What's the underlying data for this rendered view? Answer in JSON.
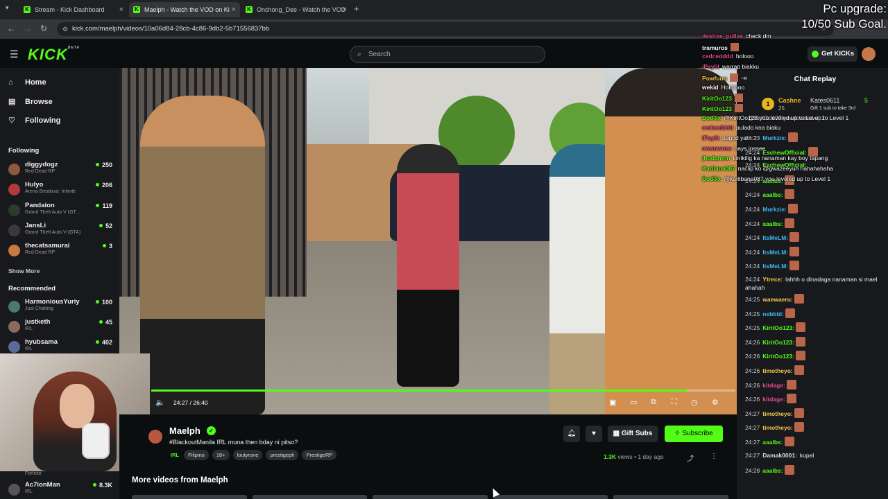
{
  "browser": {
    "tabs": [
      {
        "title": "Stream - Kick Dashboard",
        "active": false
      },
      {
        "title": "Maelph - Watch the VOD on Ki",
        "active": true
      },
      {
        "title": "Onchong_Dee - Watch the VOD",
        "active": false
      }
    ],
    "url": "kick.com/maelph/videos/10a06d84-28cb-4c86-9db2-5b71556837bb"
  },
  "header": {
    "logo": "KICK",
    "logo_sup": "BETA",
    "search_placeholder": "Search",
    "get_kicks": "Get KICKs"
  },
  "sidebar": {
    "nav": [
      {
        "label": "Home",
        "icon": "home-icon"
      },
      {
        "label": "Browse",
        "icon": "browse-icon"
      },
      {
        "label": "Following",
        "icon": "heart-icon"
      }
    ],
    "following_title": "Following",
    "following": [
      {
        "name": "diggydogz",
        "game": "Red Dead RP",
        "viewers": "250",
        "color": "#8c5a3c"
      },
      {
        "name": "Hulyo",
        "game": "Arena Breakout: Infinite",
        "viewers": "206",
        "color": "#b33a3a"
      },
      {
        "name": "Pandaion",
        "game": "Grand Theft Auto V (GT...",
        "viewers": "119",
        "color": "#2d3b2f"
      },
      {
        "name": "JansLi",
        "game": "Grand Theft Auto V (GTA)",
        "viewers": "52",
        "color": "#3a3a3a"
      },
      {
        "name": "thecatsamurai",
        "game": "Red Dead RP",
        "viewers": "3",
        "color": "#c77a42"
      }
    ],
    "show_more": "Show More",
    "recommended_title": "Recommended",
    "recommended": [
      {
        "name": "HarmoniousYuriy",
        "game": "Just Chatting",
        "viewers": "100",
        "color": "#4a7a6a"
      },
      {
        "name": "justketh",
        "game": "IRL",
        "viewers": "45",
        "color": "#8a6a5a"
      },
      {
        "name": "hyubsama",
        "game": "IRL",
        "viewers": "402",
        "color": "#5a6a9a"
      }
    ],
    "bottom_game": "Fortnite",
    "bottom_channel": {
      "name": "Ac7ionMan",
      "game": "IRL",
      "viewers": "8.3K"
    }
  },
  "video": {
    "time": "24:27 / 26:40",
    "progress": 0.917
  },
  "channel": {
    "name": "Maelph",
    "title": "#BlackoutManila IRL muna then bday ni pitso?",
    "category": "IRL",
    "tags": [
      "Filipino",
      "18+",
      "loutyrone",
      "prestigeph",
      "PrestigeRP"
    ],
    "gift_subs": "Gift Subs",
    "subscribe": "Subscribe",
    "views": "1.3K",
    "views_suffix": "views",
    "age": "1 day ago",
    "more_videos": "More videos from Maelph"
  },
  "chat": {
    "title": "Chat Replay",
    "pinned": {
      "gifter": "Cashne",
      "gifter_count": "25",
      "recipient": "Kates0611",
      "recipient_count": "5",
      "message": "Gift 1 sub to take 3rd"
    },
    "messages": [
      {
        "ts": "",
        "user": "",
        "color": "#ddd",
        "text": "@KiritOo123 you leveled up to Level 1",
        "emote": false
      },
      {
        "ts": "24:23",
        "user": "Murkzie:",
        "color": "#3fb6f0",
        "text": "",
        "emote": true
      },
      {
        "ts": "24:24",
        "user": "EschewOfficial:",
        "color": "#53fc18",
        "text": "",
        "emote": true
      },
      {
        "ts": "24:24",
        "user": "EschewOfficial:",
        "color": "#53fc18",
        "text": "",
        "emote": false
      },
      {
        "ts": "24:24",
        "user": "aaalbs:",
        "color": "#53fc18",
        "text": "",
        "emote": true
      },
      {
        "ts": "24:24",
        "user": "aaalbs:",
        "color": "#53fc18",
        "text": "",
        "emote": true
      },
      {
        "ts": "24:24",
        "user": "Murkzie:",
        "color": "#3fb6f0",
        "text": "",
        "emote": true
      },
      {
        "ts": "24:24",
        "user": "aaalbs:",
        "color": "#53fc18",
        "text": "",
        "emote": true
      },
      {
        "ts": "24:24",
        "user": "ItsMeLM:",
        "color": "#3fb6f0",
        "text": "",
        "emote": true
      },
      {
        "ts": "24:24",
        "user": "ItsMeLM:",
        "color": "#3fb6f0",
        "text": "",
        "emote": true
      },
      {
        "ts": "24:24",
        "user": "ItsMeLM:",
        "color": "#3fb6f0",
        "text": "",
        "emote": true
      },
      {
        "ts": "24:24",
        "user": "Ytrece:",
        "color": "#f2c94c",
        "text": "lahhh o dinadaga nanaman si mael ahahah",
        "emote": false
      },
      {
        "ts": "24:25",
        "user": "waewaeru:",
        "color": "#f2c94c",
        "text": "",
        "emote": true
      },
      {
        "ts": "24:25",
        "user": "nebbbl:",
        "color": "#3fb6f0",
        "text": "",
        "emote": true
      },
      {
        "ts": "24:25",
        "user": "KiritOo123:",
        "color": "#53fc18",
        "text": "",
        "emote": true
      },
      {
        "ts": "24:26",
        "user": "KiritOo123:",
        "color": "#53fc18",
        "text": "",
        "emote": true
      },
      {
        "ts": "24:26",
        "user": "KiritOo123:",
        "color": "#53fc18",
        "text": "",
        "emote": true
      },
      {
        "ts": "24:26",
        "user": "timotheyo:",
        "color": "#f2c94c",
        "text": "",
        "emote": true
      },
      {
        "ts": "24:26",
        "user": "kitdage:",
        "color": "#e04b8a",
        "text": "",
        "emote": true
      },
      {
        "ts": "24:26",
        "user": "kitdage:",
        "color": "#e04b8a",
        "text": "",
        "emote": true
      },
      {
        "ts": "24:27",
        "user": "timotheyo:",
        "color": "#f2c94c",
        "text": "",
        "emote": true
      },
      {
        "ts": "24:27",
        "user": "timotheyo:",
        "color": "#f2c94c",
        "text": "",
        "emote": true
      },
      {
        "ts": "24:27",
        "user": "aaalbs:",
        "color": "#53fc18",
        "text": "",
        "emote": true
      },
      {
        "ts": "24:27",
        "user": "Damak0001:",
        "color": "#ddd",
        "text": "kupal",
        "emote": false
      },
      {
        "ts": "24:28",
        "user": "aaalbs:",
        "color": "#53fc18",
        "text": "",
        "emote": true
      }
    ]
  },
  "overlay": {
    "goal_line1": "Pc upgrade:",
    "goal_line2": "10/50 Sub Goal.",
    "messages": [
      {
        "user": "desiree_pullas",
        "color": "#e04b8a",
        "text": "check dm"
      },
      {
        "user": "tramuros",
        "color": "#fff",
        "text": ""
      },
      {
        "user": "cedcedddd",
        "color": "#e04b8a",
        "text": "holooo"
      },
      {
        "user": "iPaylit",
        "color": "#e04b8a",
        "text": "warrap biakku"
      },
      {
        "user": "Powfuuu",
        "color": "#f2c94c",
        "text": ""
      },
      {
        "user": "wekid",
        "color": "#fff",
        "text": "Hololooo"
      },
      {
        "user": "KiritOo123",
        "color": "#53fc18",
        "text": ""
      },
      {
        "user": "KiritOo123",
        "color": "#53fc18",
        "text": ""
      },
      {
        "user": "BotRix",
        "color": "#53fc18",
        "text": "@KiritOo123 you leveled up to Level 1"
      },
      {
        "user": "cedcedddd",
        "color": "#e04b8a",
        "text": "pulado kna biaku"
      },
      {
        "user": "iPaylit",
        "color": "#e04b8a",
        "text": "pagod yarn ?"
      },
      {
        "user": "mwmwmw",
        "color": "#e04b8a",
        "text": "hays jossee"
      },
      {
        "user": "jhodamnn",
        "color": "#53fc18",
        "text": "kinikilig ka nanaman kay boy tapang"
      },
      {
        "user": "Karliana087",
        "color": "#53fc18",
        "text": "naclip ko @gwazeeyuh hahahahaha"
      },
      {
        "user": "BotRix",
        "color": "#53fc18",
        "text": "@karlibana087 you leveled up to Level 1"
      }
    ]
  }
}
